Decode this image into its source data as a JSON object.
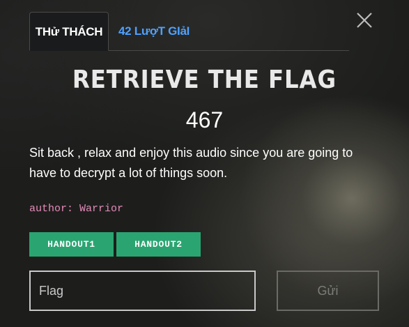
{
  "tabs": [
    {
      "label": "THử THÁCH",
      "active": true
    },
    {
      "label": "42 LượT GIảI",
      "active": false
    }
  ],
  "challenge": {
    "title": "RETRIEVE THE FLAG",
    "points": "467",
    "description": "Sit back , relax and enjoy this audio since you are going to have to decrypt a lot of things soon.",
    "author": "author: Warrior"
  },
  "files": [
    {
      "label": "HANDOUT1"
    },
    {
      "label": "HANDOUT2"
    }
  ],
  "form": {
    "flag_placeholder": "Flag",
    "submit_label": "Gửi"
  },
  "colors": {
    "accent_link": "#4ea1ff",
    "file_button": "#2aa571",
    "author_text": "#e58bb9"
  },
  "icons": {
    "close": "close-icon"
  }
}
